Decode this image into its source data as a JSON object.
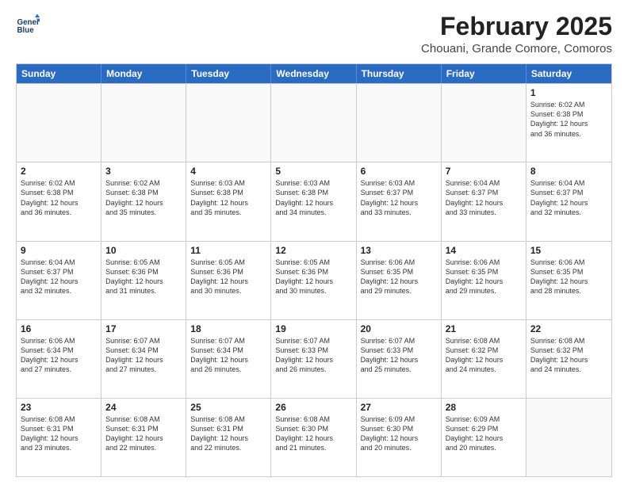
{
  "header": {
    "logo_line1": "General",
    "logo_line2": "Blue",
    "month": "February 2025",
    "location": "Chouani, Grande Comore, Comoros"
  },
  "weekdays": [
    "Sunday",
    "Monday",
    "Tuesday",
    "Wednesday",
    "Thursday",
    "Friday",
    "Saturday"
  ],
  "rows": [
    [
      {
        "day": "",
        "info": ""
      },
      {
        "day": "",
        "info": ""
      },
      {
        "day": "",
        "info": ""
      },
      {
        "day": "",
        "info": ""
      },
      {
        "day": "",
        "info": ""
      },
      {
        "day": "",
        "info": ""
      },
      {
        "day": "1",
        "info": "Sunrise: 6:02 AM\nSunset: 6:38 PM\nDaylight: 12 hours\nand 36 minutes."
      }
    ],
    [
      {
        "day": "2",
        "info": "Sunrise: 6:02 AM\nSunset: 6:38 PM\nDaylight: 12 hours\nand 36 minutes."
      },
      {
        "day": "3",
        "info": "Sunrise: 6:02 AM\nSunset: 6:38 PM\nDaylight: 12 hours\nand 35 minutes."
      },
      {
        "day": "4",
        "info": "Sunrise: 6:03 AM\nSunset: 6:38 PM\nDaylight: 12 hours\nand 35 minutes."
      },
      {
        "day": "5",
        "info": "Sunrise: 6:03 AM\nSunset: 6:38 PM\nDaylight: 12 hours\nand 34 minutes."
      },
      {
        "day": "6",
        "info": "Sunrise: 6:03 AM\nSunset: 6:37 PM\nDaylight: 12 hours\nand 33 minutes."
      },
      {
        "day": "7",
        "info": "Sunrise: 6:04 AM\nSunset: 6:37 PM\nDaylight: 12 hours\nand 33 minutes."
      },
      {
        "day": "8",
        "info": "Sunrise: 6:04 AM\nSunset: 6:37 PM\nDaylight: 12 hours\nand 32 minutes."
      }
    ],
    [
      {
        "day": "9",
        "info": "Sunrise: 6:04 AM\nSunset: 6:37 PM\nDaylight: 12 hours\nand 32 minutes."
      },
      {
        "day": "10",
        "info": "Sunrise: 6:05 AM\nSunset: 6:36 PM\nDaylight: 12 hours\nand 31 minutes."
      },
      {
        "day": "11",
        "info": "Sunrise: 6:05 AM\nSunset: 6:36 PM\nDaylight: 12 hours\nand 30 minutes."
      },
      {
        "day": "12",
        "info": "Sunrise: 6:05 AM\nSunset: 6:36 PM\nDaylight: 12 hours\nand 30 minutes."
      },
      {
        "day": "13",
        "info": "Sunrise: 6:06 AM\nSunset: 6:35 PM\nDaylight: 12 hours\nand 29 minutes."
      },
      {
        "day": "14",
        "info": "Sunrise: 6:06 AM\nSunset: 6:35 PM\nDaylight: 12 hours\nand 29 minutes."
      },
      {
        "day": "15",
        "info": "Sunrise: 6:06 AM\nSunset: 6:35 PM\nDaylight: 12 hours\nand 28 minutes."
      }
    ],
    [
      {
        "day": "16",
        "info": "Sunrise: 6:06 AM\nSunset: 6:34 PM\nDaylight: 12 hours\nand 27 minutes."
      },
      {
        "day": "17",
        "info": "Sunrise: 6:07 AM\nSunset: 6:34 PM\nDaylight: 12 hours\nand 27 minutes."
      },
      {
        "day": "18",
        "info": "Sunrise: 6:07 AM\nSunset: 6:34 PM\nDaylight: 12 hours\nand 26 minutes."
      },
      {
        "day": "19",
        "info": "Sunrise: 6:07 AM\nSunset: 6:33 PM\nDaylight: 12 hours\nand 26 minutes."
      },
      {
        "day": "20",
        "info": "Sunrise: 6:07 AM\nSunset: 6:33 PM\nDaylight: 12 hours\nand 25 minutes."
      },
      {
        "day": "21",
        "info": "Sunrise: 6:08 AM\nSunset: 6:32 PM\nDaylight: 12 hours\nand 24 minutes."
      },
      {
        "day": "22",
        "info": "Sunrise: 6:08 AM\nSunset: 6:32 PM\nDaylight: 12 hours\nand 24 minutes."
      }
    ],
    [
      {
        "day": "23",
        "info": "Sunrise: 6:08 AM\nSunset: 6:31 PM\nDaylight: 12 hours\nand 23 minutes."
      },
      {
        "day": "24",
        "info": "Sunrise: 6:08 AM\nSunset: 6:31 PM\nDaylight: 12 hours\nand 22 minutes."
      },
      {
        "day": "25",
        "info": "Sunrise: 6:08 AM\nSunset: 6:31 PM\nDaylight: 12 hours\nand 22 minutes."
      },
      {
        "day": "26",
        "info": "Sunrise: 6:08 AM\nSunset: 6:30 PM\nDaylight: 12 hours\nand 21 minutes."
      },
      {
        "day": "27",
        "info": "Sunrise: 6:09 AM\nSunset: 6:30 PM\nDaylight: 12 hours\nand 20 minutes."
      },
      {
        "day": "28",
        "info": "Sunrise: 6:09 AM\nSunset: 6:29 PM\nDaylight: 12 hours\nand 20 minutes."
      },
      {
        "day": "",
        "info": ""
      }
    ]
  ]
}
